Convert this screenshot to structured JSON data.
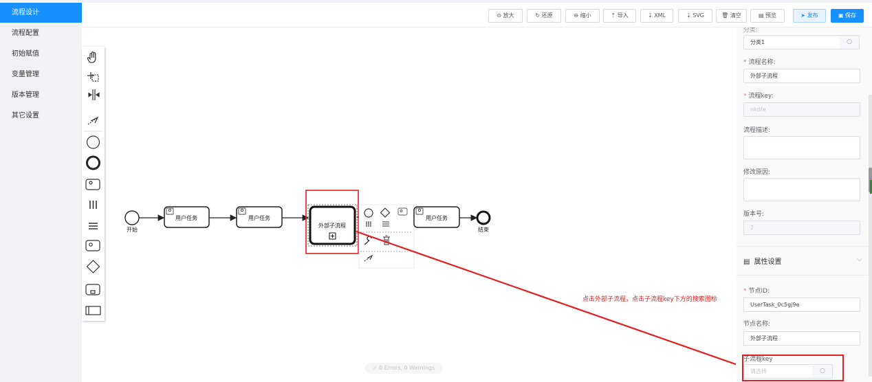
{
  "sidebar": {
    "items": [
      {
        "label": "流程设计",
        "active": true
      },
      {
        "label": "流程配置"
      },
      {
        "label": "初始赋值"
      },
      {
        "label": "变量管理"
      },
      {
        "label": "版本管理"
      },
      {
        "label": "其它设置"
      }
    ]
  },
  "toolbar": {
    "zoom_in": "⊙ 放大",
    "restore": "↻ 还原",
    "zoom_out": "⊖ 缩小",
    "import": "⇡ 导入",
    "xml": "⇣ XML",
    "svg": "⇣ SVG",
    "clear": "🗑 清空",
    "preview": "▤ 预览",
    "publish": "➤ 发布",
    "save": "▣ 保存"
  },
  "canvas": {
    "start_label": "开始",
    "task1": "用户任务",
    "task2": "用户任务",
    "subprocess": "外部子流程",
    "task3": "用户任务",
    "end_label": "结束"
  },
  "annotation": "点击外部子流程，点击子流程key下方的搜索图标",
  "status": "✓ 0 Errors, 0 Warnings",
  "panel": {
    "category_label_partial": "分类:",
    "category_value": "分类1",
    "process_name_label": "流程名称:",
    "process_name_value": "外部子流程",
    "process_key_label": "流程key:",
    "process_key_value": "nkdfe",
    "description_label": "流程描述:",
    "modify_reason_label": "修改原因:",
    "version_label": "版本号:",
    "version_value": "2",
    "section_title": "属性设置",
    "node_id_label": "节点ID:",
    "node_id_value": "UserTask_0c5gj9e",
    "node_name_label": "节点名称:",
    "node_name_value": "外部子流程",
    "subprocess_key_label": "子流程key",
    "subprocess_key_placeholder": "请选择"
  },
  "colors": {
    "primary": "#1890ff",
    "highlight": "#e02020",
    "sidebar_bg": "#f0f2f5"
  }
}
